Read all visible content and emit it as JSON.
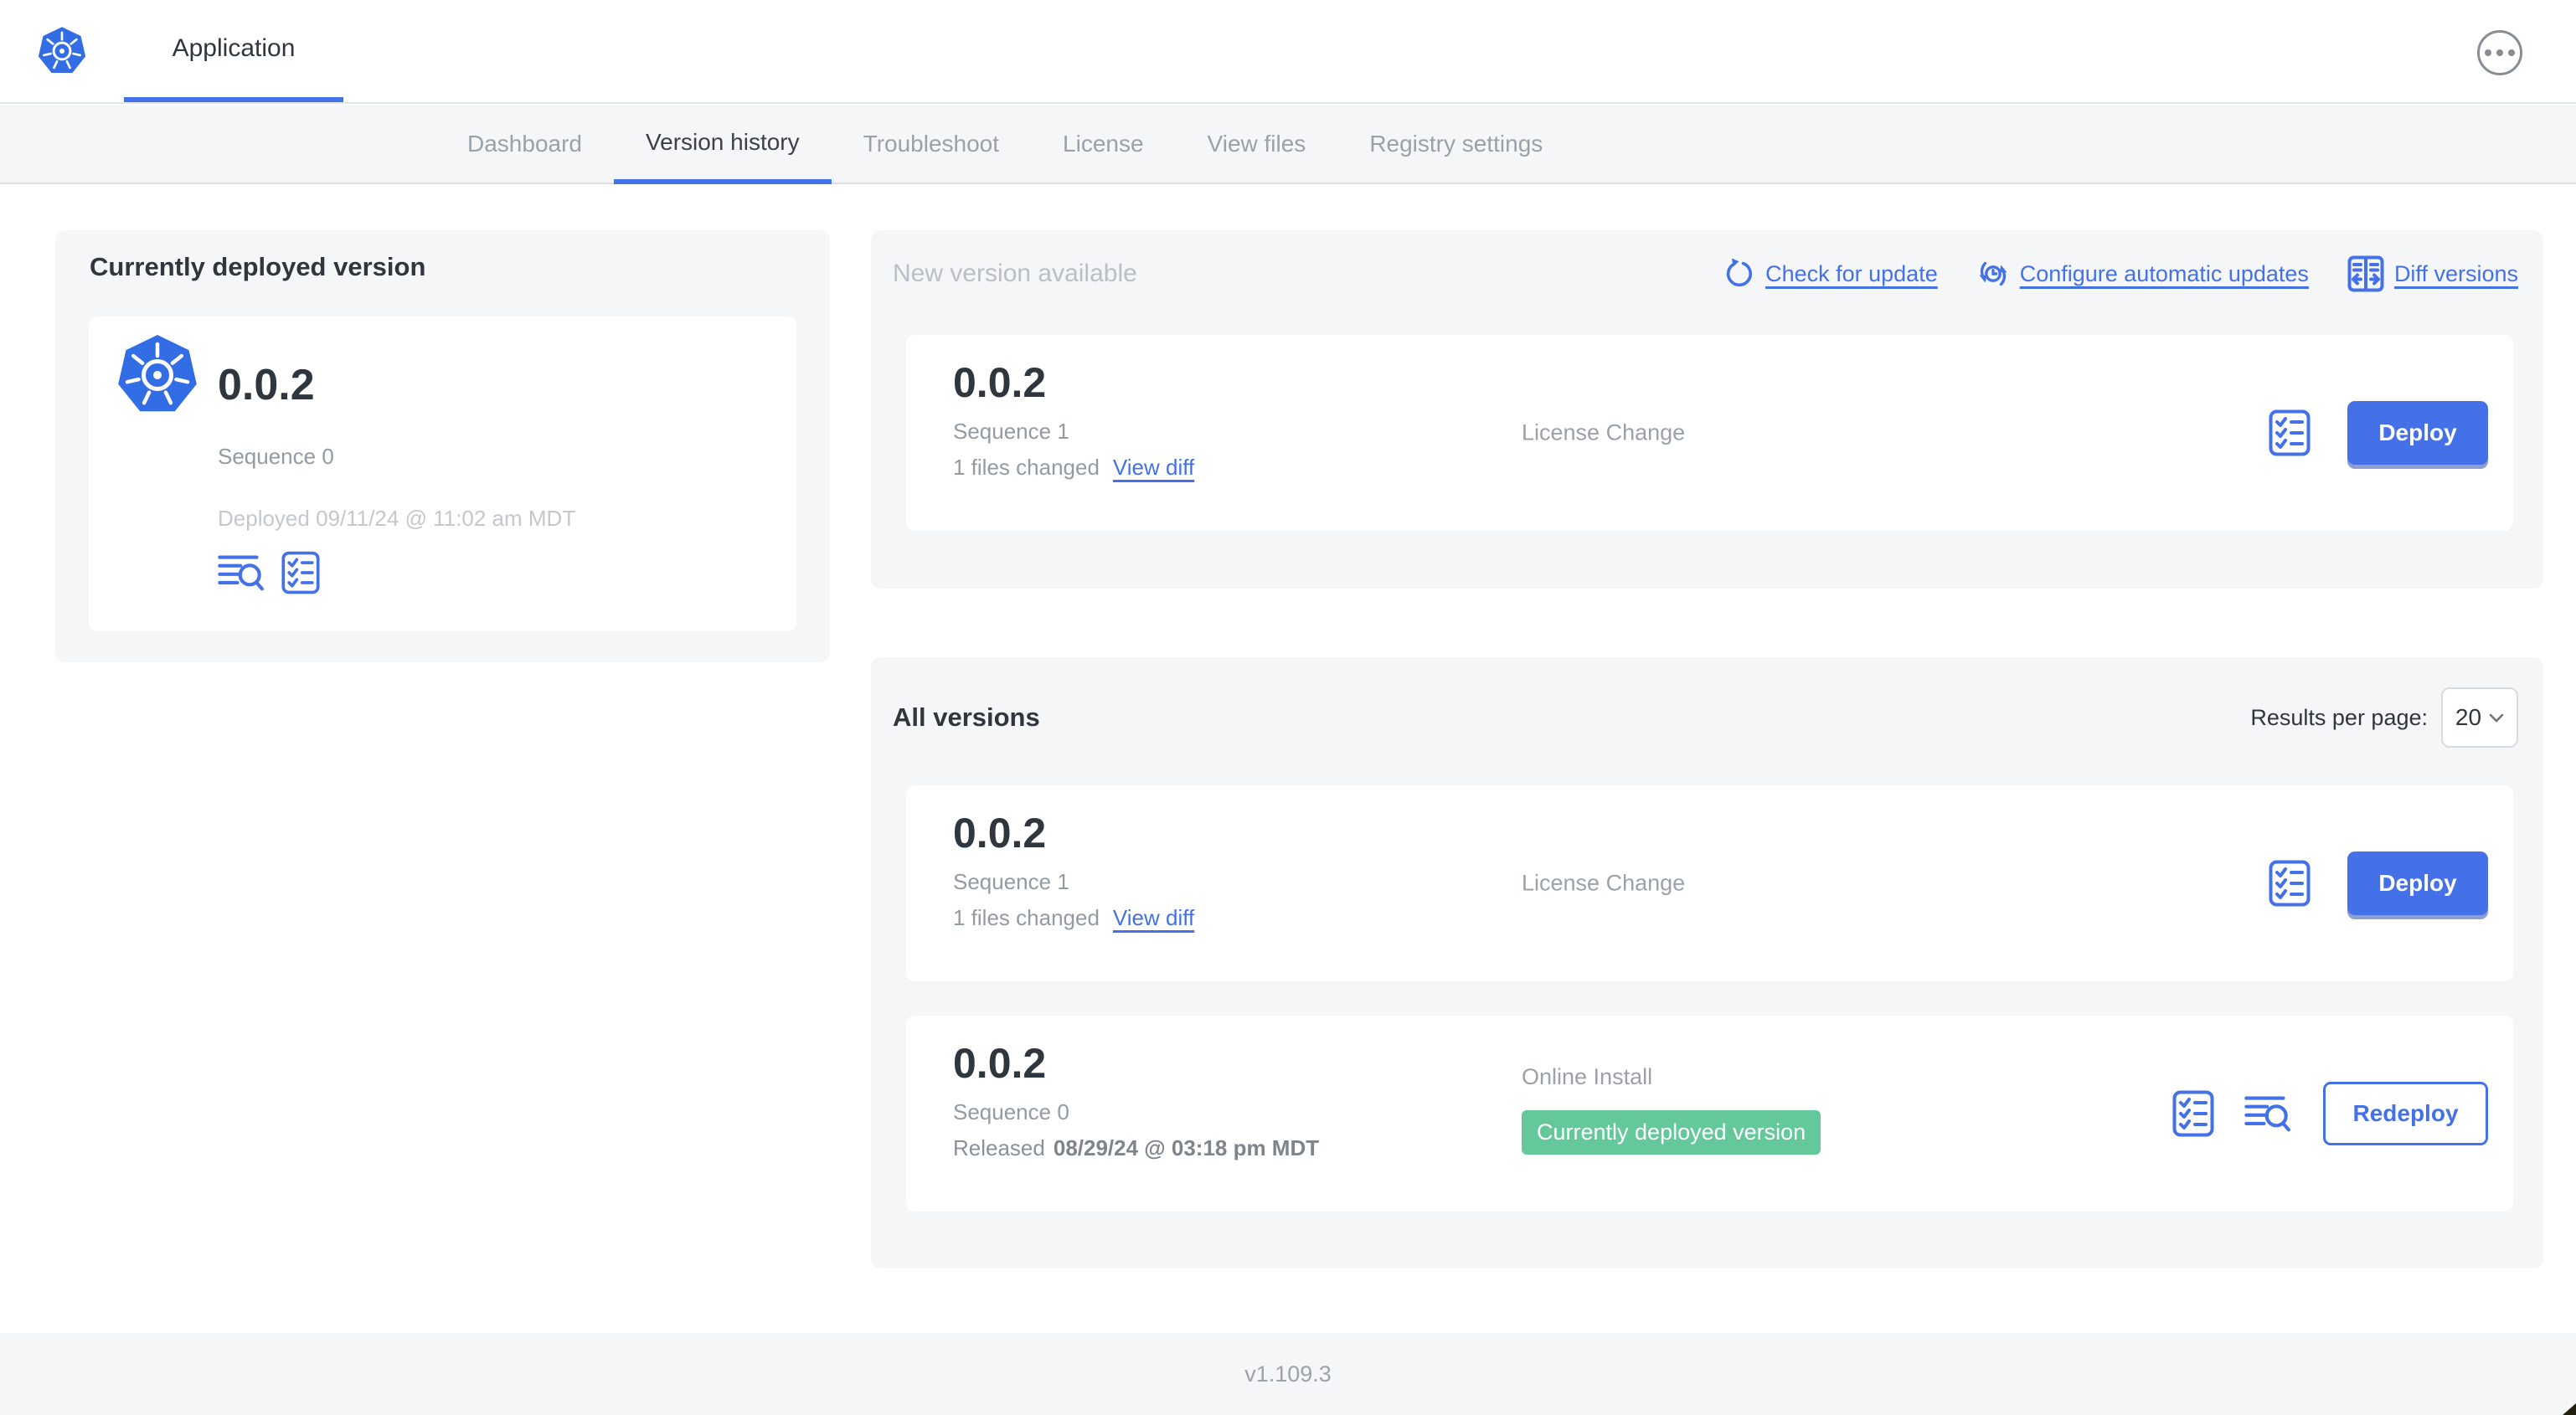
{
  "colors": {
    "accent": "#4571E8",
    "logo_blue": "#326DE6",
    "green": "#65C89B",
    "panel_gray": "#F5F6F8"
  },
  "header": {
    "app_tab_label": "Application"
  },
  "nav": {
    "tabs": [
      {
        "label": "Dashboard",
        "active": false
      },
      {
        "label": "Version history",
        "active": true
      },
      {
        "label": "Troubleshoot",
        "active": false
      },
      {
        "label": "License",
        "active": false
      },
      {
        "label": "View files",
        "active": false
      },
      {
        "label": "Registry settings",
        "active": false
      }
    ]
  },
  "current": {
    "title": "Currently deployed version",
    "version": "0.0.2",
    "sequence": "Sequence 0",
    "deployed": "Deployed 09/11/24 @ 11:02 am MDT"
  },
  "new_version": {
    "title": "New version available",
    "check_link": "Check for update",
    "configure_link": "Configure automatic updates",
    "diff_link": "Diff versions",
    "card": {
      "version": "0.0.2",
      "sequence": "Sequence 1",
      "files_changed": "1 files changed",
      "view_diff": "View diff",
      "change_type": "License Change",
      "action_label": "Deploy"
    }
  },
  "all_versions": {
    "title": "All versions",
    "results_label": "Results per page:",
    "results_value": "20",
    "rows": [
      {
        "version": "0.0.2",
        "sequence": "Sequence 1",
        "files_changed": "1 files changed",
        "view_diff": "View diff",
        "middle": "License Change",
        "action_label": "Deploy"
      },
      {
        "version": "0.0.2",
        "sequence": "Sequence 0",
        "released_prefix": "Released",
        "released_date": "08/29/24 @ 03:18 pm MDT",
        "middle": "Online Install",
        "badge": "Currently deployed version",
        "action_label": "Redeploy"
      }
    ]
  },
  "footer": {
    "app_version": "v1.109.3"
  }
}
